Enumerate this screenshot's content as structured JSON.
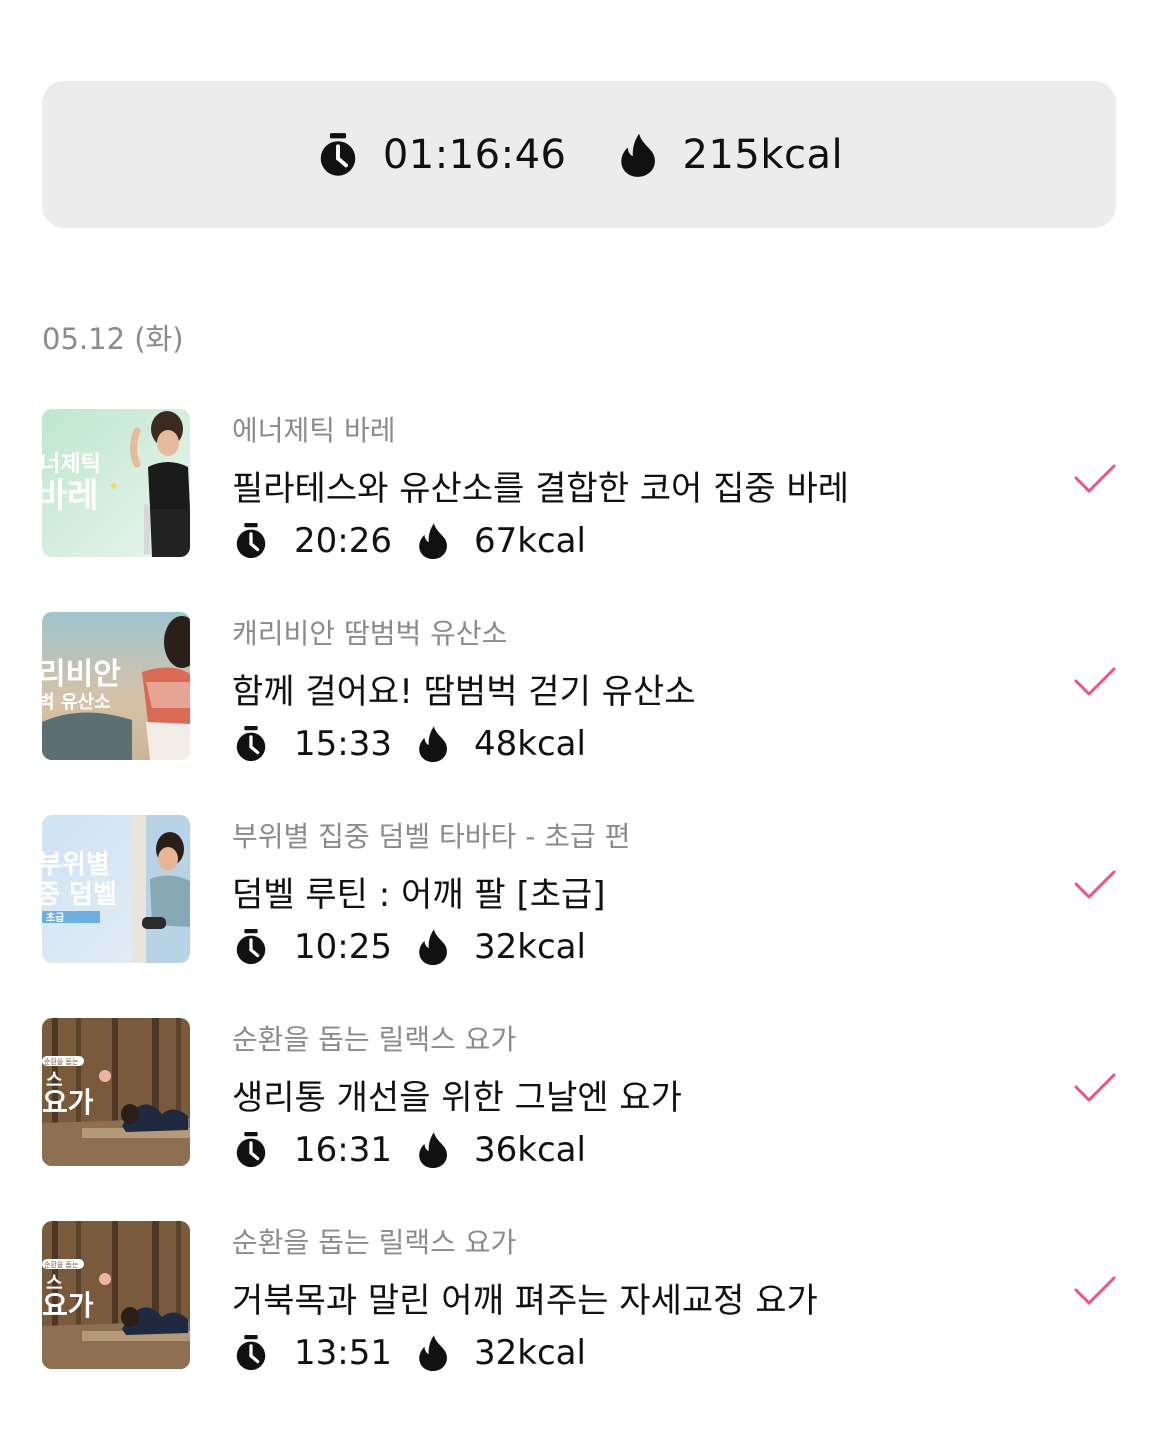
{
  "summary": {
    "total_time": "01:16:46",
    "total_kcal": "215kcal",
    "time_icon": "stopwatch-icon",
    "kcal_icon": "flame-icon"
  },
  "date_label": "05.12 (화)",
  "accent_color": "#f0508c",
  "workouts": [
    {
      "program": "에너제틱 바레",
      "title": "필라테스와 유산소를 결합한 코어 집중 바레",
      "duration": "20:26",
      "kcal": "67kcal",
      "thumb_text": [
        "너제틱",
        "바레"
      ]
    },
    {
      "program": "캐리비안 땀범벅 유산소",
      "title": "함께 걸어요! 땀범벅 걷기 유산소",
      "duration": "15:33",
      "kcal": "48kcal",
      "thumb_text": [
        "리비안",
        "벅 유산소"
      ]
    },
    {
      "program": "부위별 집중 덤벨 타바타 - 초급 편",
      "title": "덤벨 루틴 : 어깨 팔 [초급]",
      "duration": "10:25",
      "kcal": "32kcal",
      "thumb_text": [
        "부위별",
        "중 덤벨",
        "초급"
      ]
    },
    {
      "program": "순환을 돕는 릴랙스 요가",
      "title": "생리통 개선을 위한 그날엔 요가",
      "duration": "16:31",
      "kcal": "36kcal",
      "thumb_text": [
        "순환을 돕는",
        "스",
        "요가"
      ]
    },
    {
      "program": "순환을 돕는 릴랙스 요가",
      "title": "거북목과 말린 어깨 펴주는 자세교정 요가",
      "duration": "13:51",
      "kcal": "32kcal",
      "thumb_text": [
        "순환을 돕는",
        "스",
        "요가"
      ]
    }
  ]
}
